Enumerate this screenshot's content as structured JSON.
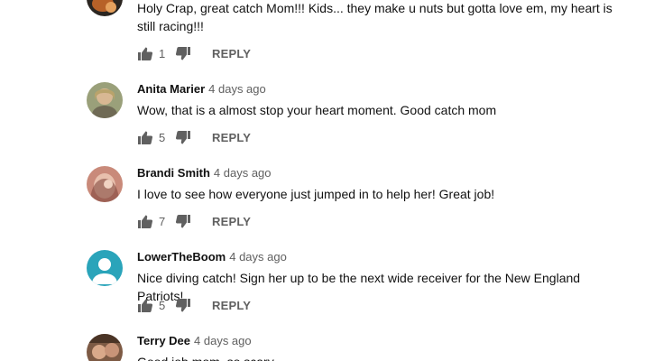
{
  "comments": [
    {
      "author": "",
      "time": "",
      "text": "Holy Crap, great catch Mom!!! Kids... they make u nuts but gotta love em, my heart is still racing!!!",
      "likes": "1",
      "reply_label": "REPLY",
      "avatar_icon": "user-photo-avatar"
    },
    {
      "author": "Anita Marier",
      "time": "4 days ago",
      "text": "Wow, that is a almost stop your heart moment.  Good catch mom",
      "likes": "5",
      "reply_label": "REPLY",
      "avatar_icon": "user-photo-avatar"
    },
    {
      "author": "Brandi Smith",
      "time": "4 days ago",
      "text": "I love to see how everyone just jumped in to help her!  Great job!",
      "likes": "7",
      "reply_label": "REPLY",
      "avatar_icon": "user-photo-avatar"
    },
    {
      "author": "LowerTheBoom",
      "time": "4 days ago",
      "text": "Nice diving catch! Sign her up to be the next wide receiver for the New England Patriots!",
      "likes": "5",
      "reply_label": "REPLY",
      "avatar_icon": "default-user-avatar"
    },
    {
      "author": "Terry Dee",
      "time": "4 days ago",
      "text": "Good job mom, so scary",
      "likes": "",
      "reply_label": "",
      "avatar_icon": "user-photo-avatar"
    }
  ],
  "icons": {
    "like": "thumbs-up-icon",
    "dislike": "thumbs-down-icon"
  },
  "colors": {
    "text_primary": "#111111",
    "text_secondary": "#606060",
    "default_avatar": "#2aa4ba"
  }
}
